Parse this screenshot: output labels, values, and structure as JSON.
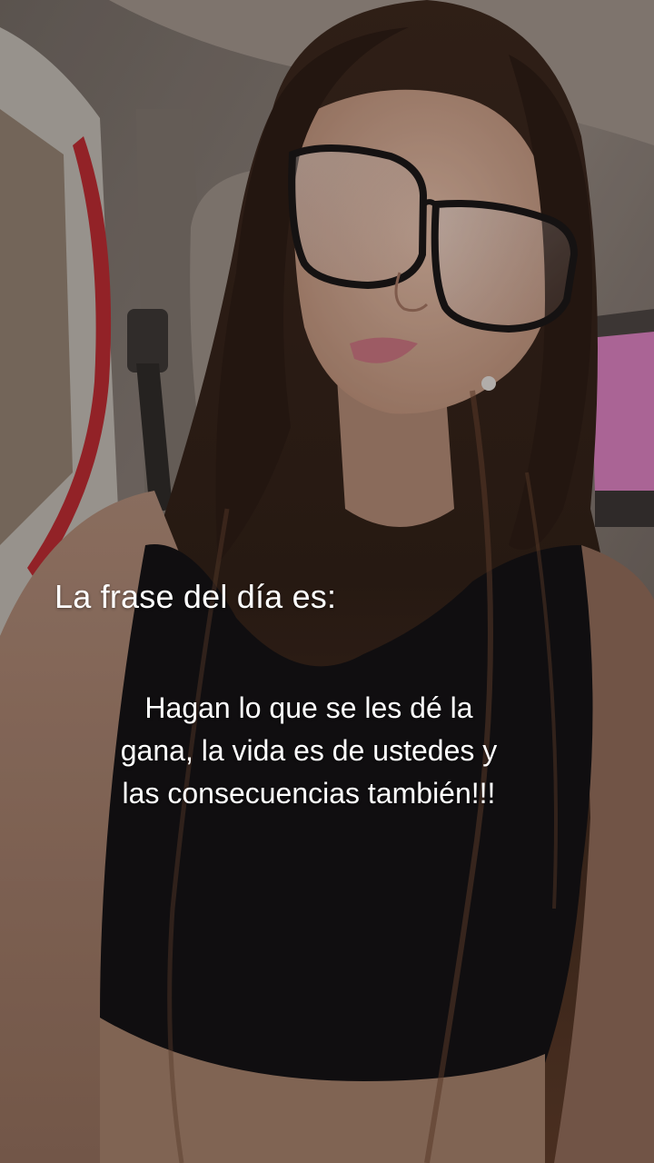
{
  "overlay": {
    "title": "La frase del día es:",
    "quote_lines": [
      "Hagan lo que se les dé la",
      "gana, la vida es de ustedes y",
      "las consecuencias también!!!"
    ]
  },
  "colors": {
    "text": "#ffffff",
    "hair": "#2b1b14",
    "skin": "#c9a48e",
    "top": "#141214",
    "car_interior": "#8a7f78",
    "car_red_trim": "#b22a30",
    "window_pink": "#d07ab6"
  },
  "icons": {
    "photo": "selfie-photo"
  }
}
